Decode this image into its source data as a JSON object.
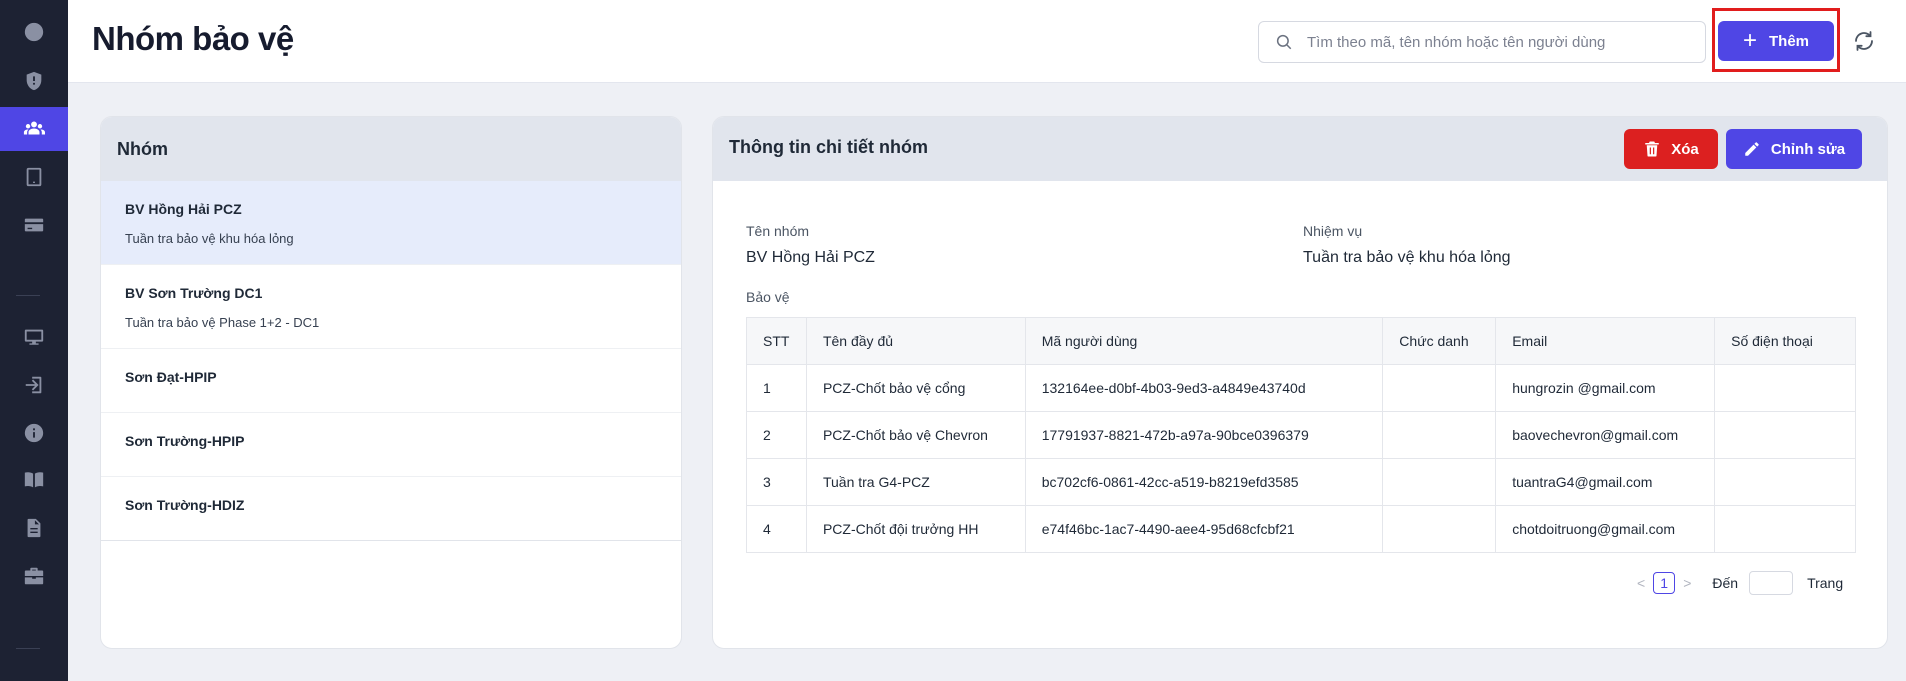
{
  "sidebar": {
    "items": [
      {
        "icon": "clock-icon"
      },
      {
        "icon": "shield-icon"
      },
      {
        "icon": "users-icon",
        "active": true
      },
      {
        "icon": "tablet-icon"
      },
      {
        "icon": "card-icon"
      },
      {
        "icon": "monitor-icon"
      },
      {
        "icon": "login-icon"
      },
      {
        "icon": "info-icon"
      },
      {
        "icon": "book-icon"
      },
      {
        "icon": "document-icon"
      },
      {
        "icon": "briefcase-icon"
      }
    ]
  },
  "header": {
    "title": "Nhóm bảo vệ",
    "search_placeholder": "Tìm theo mã, tên nhóm hoặc tên người dùng",
    "add_label": "Thêm"
  },
  "groups": {
    "title": "Nhóm",
    "items": [
      {
        "name": "BV Hồng Hải PCZ",
        "desc": "Tuần tra bảo vệ khu hóa lỏng",
        "selected": true
      },
      {
        "name": "BV Sơn Trường DC1",
        "desc": "Tuần tra bảo vệ Phase 1+2 - DC1"
      },
      {
        "name": "Sơn Đạt-HPIP",
        "desc": ""
      },
      {
        "name": "Sơn Trường-HPIP",
        "desc": ""
      },
      {
        "name": "Sơn Trường-HDIZ",
        "desc": ""
      }
    ]
  },
  "detail": {
    "title": "Thông tin chi tiết nhóm",
    "delete_label": "Xóa",
    "edit_label": "Chỉnh sửa",
    "name_label": "Tên nhóm",
    "name_value": "BV Hồng Hải PCZ",
    "duty_label": "Nhiệm vụ",
    "duty_value": "Tuần tra bảo vệ khu hóa lỏng",
    "guards_label": "Bảo vệ",
    "columns": [
      "STT",
      "Tên đầy đủ",
      "Mã người dùng",
      "Chức danh",
      "Email",
      "Số điện thoại"
    ],
    "rows": [
      [
        "1",
        "PCZ-Chốt bảo vệ cổng",
        "132164ee-d0bf-4b03-9ed3-a4849e43740d",
        "",
        "hungrozin @gmail.com",
        ""
      ],
      [
        "2",
        "PCZ-Chốt bảo vệ Chevron",
        "17791937-8821-472b-a97a-90bce0396379",
        "",
        "baovechevron@gmail.com",
        ""
      ],
      [
        "3",
        "Tuần tra G4-PCZ",
        "bc702cf6-0861-42cc-a519-b8219efd3585",
        "",
        "tuantraG4@gmail.com",
        ""
      ],
      [
        "4",
        "PCZ-Chốt đội trưởng HH",
        "e74f46bc-1ac7-4490-aee4-95d68cfcbf21",
        "",
        "chotdoitruong@gmail.com",
        ""
      ]
    ],
    "pagination": {
      "prev": "<",
      "current": "1",
      "next": ">",
      "goto_label": "Đến",
      "page_label": "Trang"
    }
  },
  "colors": {
    "accent": "#4f46e5",
    "danger": "#dc2020",
    "sidebar_bg": "#1d2233",
    "highlight_box": "#e11d1d"
  }
}
